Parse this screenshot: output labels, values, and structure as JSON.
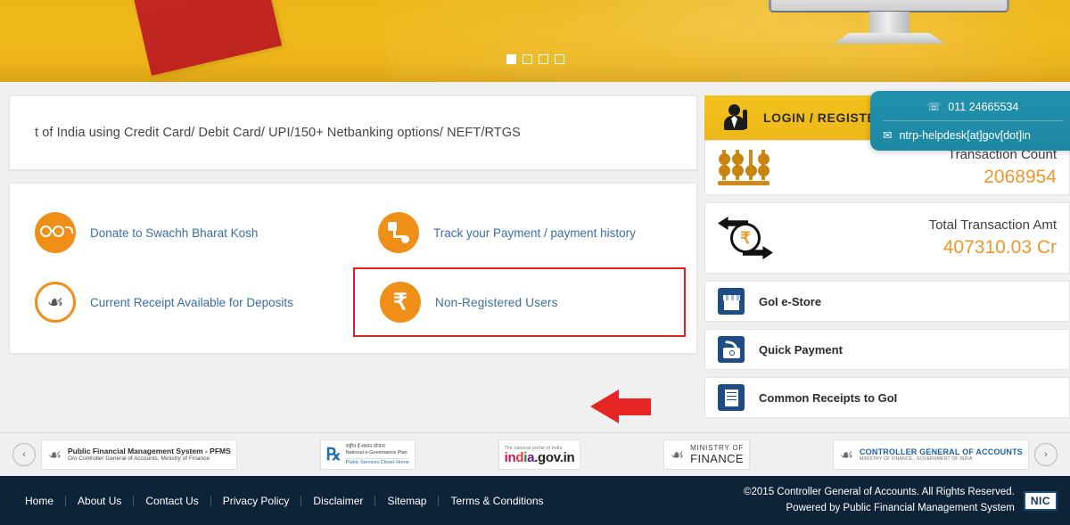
{
  "banner": {
    "carousel": {
      "slides": 4,
      "active_index": 0
    }
  },
  "intro": {
    "text": "t of India using Credit Card/ Debit Card/ UPI/150+ Netbanking options/ NEFT/RTGS"
  },
  "quick_links": [
    {
      "label": "Donate to Swachh Bharat Kosh",
      "icon": "glasses-icon",
      "highlighted": false
    },
    {
      "label": "Track your Payment / payment history",
      "icon": "track-payment-icon",
      "highlighted": false
    },
    {
      "label": "Current Receipt Available for Deposits",
      "icon": "emblem-icon",
      "highlighted": false
    },
    {
      "label": "Non-Registered Users",
      "icon": "rupee-icon",
      "highlighted": true
    }
  ],
  "sidebar": {
    "login_label": "LOGIN / REGISTER",
    "login_icon": "user-icon",
    "helpdesk": {
      "phone": "011 24665534",
      "phone_icon": "phone-icon",
      "email": "ntrp-helpdesk[at]gov[dot]in",
      "email_icon": "mail-icon"
    },
    "stats": [
      {
        "label": "Transaction Count",
        "value": "2068954",
        "icon": "abacus-icon"
      },
      {
        "label": "Total Transaction Amt",
        "value": "407310.03 Cr",
        "icon": "rupee-exchange-icon"
      }
    ],
    "menu": [
      {
        "label": "GoI e-Store",
        "icon": "store-icon"
      },
      {
        "label": "Quick Payment",
        "icon": "quick-payment-icon"
      },
      {
        "label": "Common Receipts to GoI",
        "icon": "receipt-icon"
      }
    ]
  },
  "logo_bar": {
    "prev_label": "‹",
    "next_label": "›",
    "logos": [
      {
        "name": "pfms-logo",
        "line1": "Public Financial Management System - PFMS",
        "line2": "O/o Controller General of Accounts, Ministry of Finance"
      },
      {
        "name": "egov-logo",
        "line1": "राष्ट्रीय ई-शासन योजना",
        "line2": "National e-Governance Plan",
        "line3": "Public Services Closer Home"
      },
      {
        "name": "india-gov-logo",
        "tagline": "The national portal of India",
        "text": "india.gov.in"
      },
      {
        "name": "ministry-of-finance-logo",
        "line1": "MINISTRY OF",
        "line2": "FINANCE"
      },
      {
        "name": "cga-logo",
        "line1": "CONTROLLER GENERAL OF ACCOUNTS",
        "line2": "MINISTRY OF FINANCE., GOVERNMENT OF INDIA"
      }
    ]
  },
  "footer": {
    "links": [
      "Home",
      "About Us",
      "Contact Us",
      "Privacy Policy",
      "Disclaimer",
      "Sitemap",
      "Terms & Conditions"
    ],
    "copyright": "©2015 Controller General of Accounts. All Rights Reserved.",
    "powered_by": "Powered by   Public Financial Management System",
    "nic_label": "NIC"
  },
  "colors": {
    "banner_yellow": "#edb71a",
    "accent_orange": "#ef8f18",
    "link_blue": "#3a6ea5",
    "helpdesk_teal": "#2191ad",
    "footer_navy": "#0d2438",
    "highlight_red": "#e02020",
    "stat_value_orange": "#f0962a",
    "menu_icon_blue": "#1e4c84"
  }
}
